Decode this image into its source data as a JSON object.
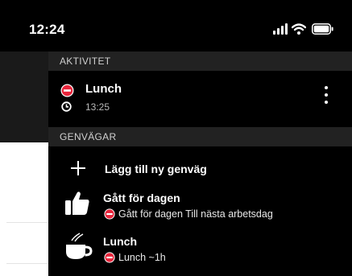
{
  "status_bar": {
    "time": "12:24",
    "icons": [
      "signal-icon",
      "wifi-icon",
      "battery-icon"
    ]
  },
  "activity": {
    "header": "AKTIVITET",
    "current": {
      "title": "Lunch",
      "time": "13:25",
      "icons": [
        "no-entry-icon",
        "clock-icon",
        "kebab-menu-icon"
      ]
    }
  },
  "shortcuts": {
    "header": "GENVÄGAR",
    "add_label": "Lägg till ny genväg",
    "items": [
      {
        "title": "Gått för dagen",
        "subtitle": "Gått för dagen Till nästa arbetsdag",
        "icon": "thumbs-up-icon",
        "status_icon": "no-entry-icon"
      },
      {
        "title": "Lunch",
        "subtitle": "Lunch ~1h",
        "icon": "coffee-icon",
        "status_icon": "no-entry-icon"
      }
    ]
  },
  "colors": {
    "panel_bg": "#000000",
    "section_header_bg": "#222222",
    "status_red": "#e8253b",
    "text_primary": "#ffffff",
    "text_secondary": "#b8b8b8"
  }
}
